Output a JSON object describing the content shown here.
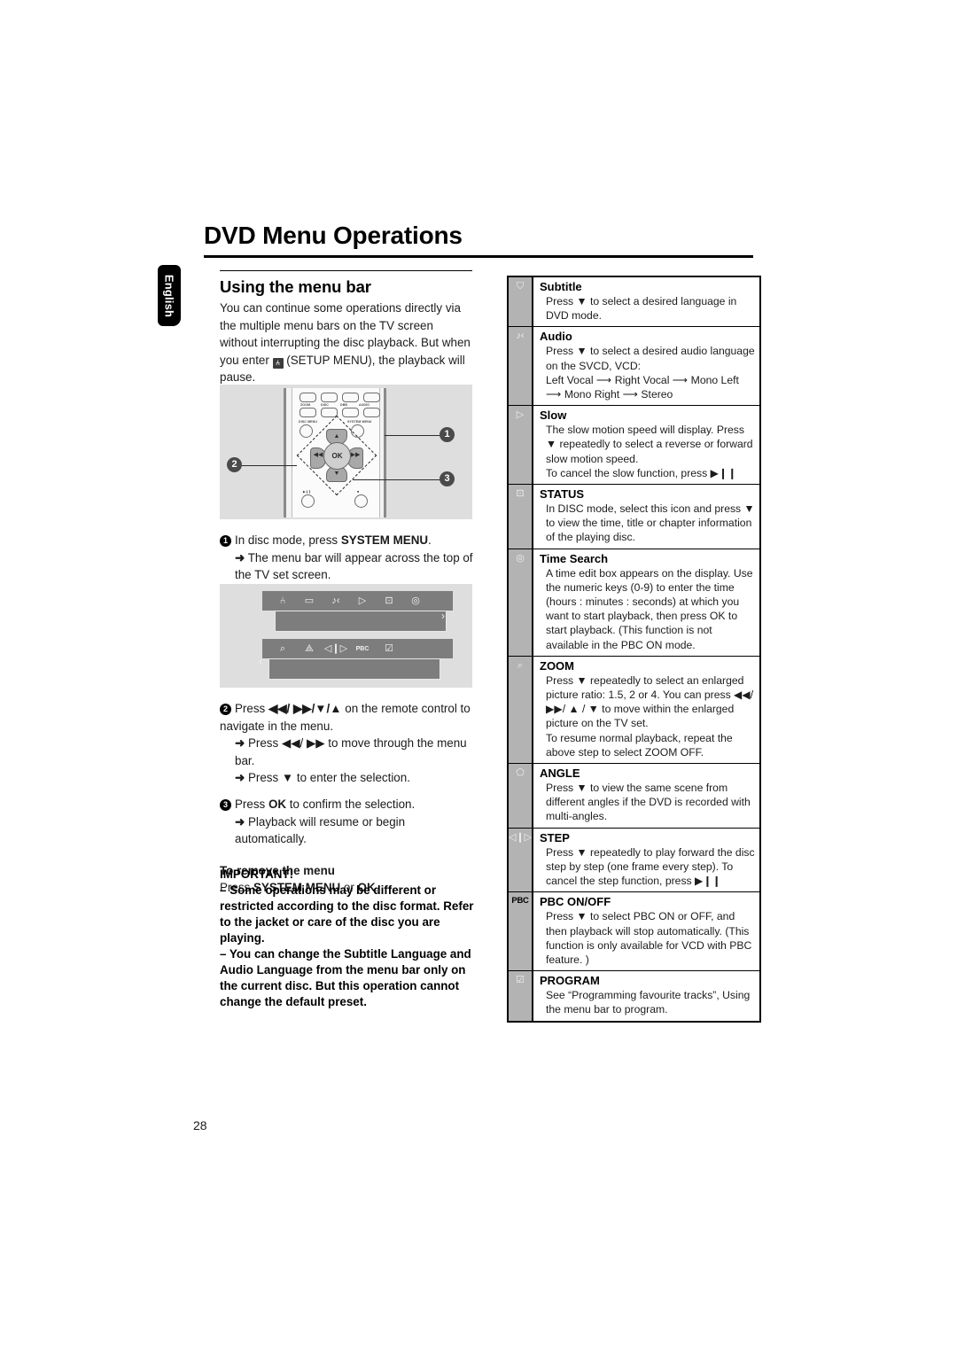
{
  "document": {
    "title": "DVD Menu Operations",
    "language_tab": "English",
    "page_number": "28"
  },
  "left_column": {
    "section_heading": "Using the menu bar",
    "intro_part1": "You can continue some operations directly via the multiple menu bars on the TV screen without interrupting the disc playback. But when you enter ",
    "intro_icon": "setup-menu-icon",
    "intro_part2": " (SETUP MENU), the playback will pause.",
    "remote_figure": {
      "name": "remote-control-diagram",
      "top_buttons": [
        "ZOOM",
        "DISC",
        "DBB",
        "AUDIO"
      ],
      "menu_buttons": [
        "DISC MENU",
        "SYSTEM MENU"
      ],
      "ok_label": "OK",
      "callouts": [
        "1",
        "2",
        "3"
      ]
    },
    "menubar_figure": {
      "name": "on-screen-menu-bar-diagram",
      "row1_icons": [
        "setup-icon",
        "subtitle-icon",
        "audio-icon",
        "slow-icon",
        "status-icon",
        "time-search-icon"
      ],
      "row2_icons": [
        "zoom-icon",
        "angle-icon",
        "step-icon",
        "pbc-icon",
        "program-icon"
      ],
      "row2_pbc_label": "PBC"
    },
    "steps": [
      {
        "num": "1",
        "text_before": "In disc mode, press ",
        "bold": "SYSTEM MENU",
        "text_after": ".",
        "subs": [
          "The menu bar will appear across the top of the TV set screen."
        ]
      },
      {
        "num": "2",
        "text_before": "Press ",
        "bold": "◀◀/ ▶▶/▼/▲",
        "text_after": " on the remote control to navigate in the menu.",
        "subs": [
          "Press ◀◀/ ▶▶ to move through the menu bar.",
          "Press ▼ to enter the selection."
        ]
      },
      {
        "num": "3",
        "text_before": "Press ",
        "bold": "OK",
        "text_after": " to confirm the selection.",
        "subs": [
          "Playback will resume or begin automatically."
        ]
      }
    ],
    "remove_menu": {
      "heading": "To remove the menu",
      "text_before": "Press ",
      "bold1": "SYSTEM MENU",
      "text_mid": " or ",
      "bold2": "OK",
      "text_after": "."
    },
    "important": {
      "heading": "IMPORTANT!",
      "bullets": [
        "–  Some operations may be different or restricted according to the disc format. Refer to the jacket or care of the disc you are playing.",
        "–  You can change the Subtitle Language and Audio Language from the menu bar only on the current disc. But this operation cannot change the default preset."
      ]
    }
  },
  "function_table": {
    "name": "menu-bar-function-table",
    "rows": [
      {
        "icon": "subtitle-icon",
        "icon_glyph": "⛉",
        "title": "Subtitle",
        "desc": "Press ▼ to select a desired language in DVD mode."
      },
      {
        "icon": "audio-icon",
        "icon_glyph": "♪‹",
        "title": "Audio",
        "desc": "Press ▼ to select a desired audio language on the SVCD, VCD:\nLeft Vocal ⟶ Right Vocal ⟶ Mono Left ⟶ Mono Right ⟶ Stereo"
      },
      {
        "icon": "slow-icon",
        "icon_glyph": "▷",
        "title": "Slow",
        "desc": "The slow motion speed will display. Press ▼ repeatedly to select a reverse or forward slow motion speed.\nTo cancel the slow function, press ▶❙❙"
      },
      {
        "icon": "status-icon",
        "icon_glyph": "⊡",
        "title": "STATUS",
        "desc": "In DISC mode, select this icon and press ▼ to view the time, title or chapter information of the playing disc."
      },
      {
        "icon": "time-search-icon",
        "icon_glyph": "◎",
        "title": "Time Search",
        "desc": "A time edit box appears on the display. Use the numeric keys (0-9) to enter the time (hours : minutes : seconds) at which you want to start playback, then press OK to start playback. (This function is not available in the PBC ON mode."
      },
      {
        "icon": "zoom-icon",
        "icon_glyph": "⌕",
        "title": "ZOOM",
        "desc": "Press ▼ repeatedly to select an enlarged picture ratio: 1.5, 2 or 4. You can press ◀◀/ ▶▶/ ▲ / ▼ to move within the enlarged picture on the TV set.\nTo resume normal playback, repeat the above step to select ZOOM OFF."
      },
      {
        "icon": "angle-icon",
        "icon_glyph": "⬠",
        "title": "ANGLE",
        "desc": "Press ▼ to view the same scene from different angles  if the DVD is recorded with multi-angles."
      },
      {
        "icon": "step-icon",
        "icon_glyph": "◁❙▷",
        "title": "STEP",
        "desc": "Press ▼ repeatedly to play forward the disc step by step (one frame every step). To cancel the step function, press ▶❙❙"
      },
      {
        "icon": "pbc-icon",
        "icon_glyph": "PBC",
        "title": "PBC ON/OFF",
        "desc": "Press ▼ to select PBC ON or OFF, and then playback will stop automatically. (This function is only available for VCD with PBC feature. )"
      },
      {
        "icon": "program-icon",
        "icon_glyph": "☑",
        "title": "PROGRAM",
        "desc": "See “Programming favourite tracks”, Using the menu bar to program."
      }
    ]
  }
}
